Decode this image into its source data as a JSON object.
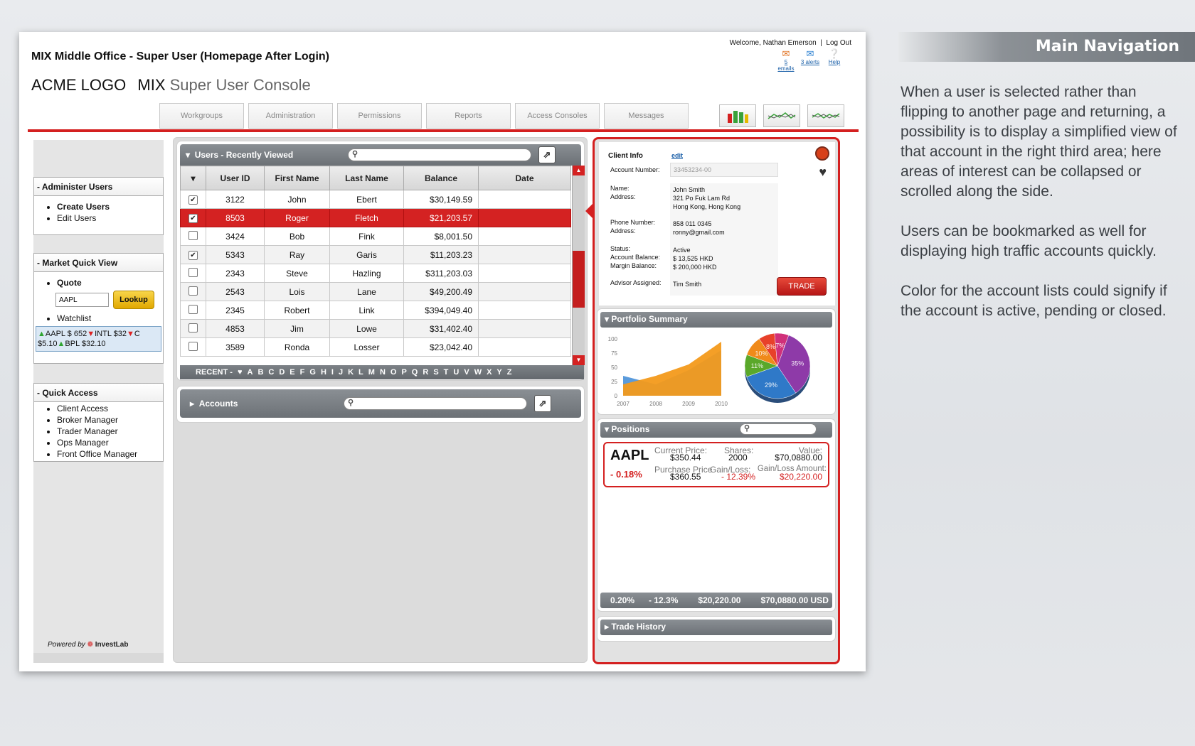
{
  "doc_title": "MIX Middle Office - Super User (Homepage After Login)",
  "header": {
    "welcome": "Welcome, Nathan Emerson",
    "logout": "Log Out",
    "emails": "5 emails",
    "alerts": "3 alerts",
    "help": "Help",
    "logo": "ACME LOGO",
    "app_mix": "MIX",
    "app_console": "Super User Console"
  },
  "tabs": [
    "Workgroups",
    "Administration",
    "Permissions",
    "Reports",
    "Access Consoles",
    "Messages"
  ],
  "sidebar": {
    "administer_title": "- Administer Users",
    "administer_items": [
      "Create Users",
      "Edit Users"
    ],
    "market_title": "- Market Quick View",
    "quote_label": "Quote",
    "quote_value": "AAPL",
    "lookup_label": "Lookup",
    "watchlist_label": "Watchlist",
    "watch_line1": "AAPL  $ 652",
    "watch_line1b": "INTL  $32",
    "watch_line1c": "C",
    "watch_line2": "$5.10",
    "watch_line2b": "BPL  $32.10",
    "quick_title": "- Quick Access",
    "quick_items": [
      "Client Access",
      "Broker Manager",
      "Trader Manager",
      "Ops Manager",
      "Front Office Manager"
    ],
    "powered_by": "Powered by",
    "brand": "InvestLab"
  },
  "users_grid": {
    "title": "Users - Recently Viewed",
    "columns": [
      "▾",
      "User ID",
      "First Name",
      "Last Name",
      "Balance",
      "Date"
    ],
    "rows": [
      {
        "checked": true,
        "id": "3122",
        "first": "John",
        "last": "Ebert",
        "balance": "$30,149.59",
        "date": ""
      },
      {
        "checked": true,
        "id": "8503",
        "first": "Roger",
        "last": "Fletch",
        "balance": "$21,203.57",
        "date": "",
        "selected": true
      },
      {
        "checked": false,
        "id": "3424",
        "first": "Bob",
        "last": "Fink",
        "balance": "$8,001.50",
        "date": ""
      },
      {
        "checked": true,
        "id": "5343",
        "first": "Ray",
        "last": "Garis",
        "balance": "$11,203.23",
        "date": ""
      },
      {
        "checked": false,
        "id": "2343",
        "first": "Steve",
        "last": "Hazling",
        "balance": "$311,203.03",
        "date": ""
      },
      {
        "checked": false,
        "id": "2543",
        "first": "Lois",
        "last": "Lane",
        "balance": "$49,200.49",
        "date": ""
      },
      {
        "checked": false,
        "id": "2345",
        "first": "Robert",
        "last": "Link",
        "balance": "$394,049.40",
        "date": ""
      },
      {
        "checked": false,
        "id": "4853",
        "first": "Jim",
        "last": "Lowe",
        "balance": "$31,402.40",
        "date": ""
      },
      {
        "checked": false,
        "id": "3589",
        "first": "Ronda",
        "last": "Losser",
        "balance": "$23,042.40",
        "date": ""
      }
    ],
    "alpha_recent": "RECENT  -",
    "alpha_heart": "♥",
    "letters": [
      "A",
      "B",
      "C",
      "D",
      "E",
      "F",
      "G",
      "H",
      "I",
      "J",
      "K",
      "L",
      "M",
      "N",
      "O",
      "P",
      "Q",
      "R",
      "S",
      "T",
      "U",
      "V",
      "W",
      "X",
      "Y",
      "Z"
    ]
  },
  "accounts": {
    "title": "Accounts"
  },
  "client": {
    "title": "Client Info",
    "edit": "edit",
    "account_number_label": "Account Number:",
    "account_number": "33453234-00",
    "name_label": "Name:",
    "address_label": "Address:",
    "name": "John Smith",
    "address1": "321 Po Fuk Lam Rd",
    "address2": "Hong Kong, Hong Kong",
    "phone_label": "Phone Number:",
    "email_label": "Address:",
    "phone": "858 011 0345",
    "email": "ronny@gmail.com",
    "status_label": "Status:",
    "acct_bal_label": "Account Balance:",
    "margin_label": "Margin Balance:",
    "status": "Active",
    "acct_bal": "$ 13,525 HKD",
    "margin": "$ 200,000 HKD",
    "advisor_label": "Advisor Assigned:",
    "advisor": "Tim Smith",
    "trade": "TRADE"
  },
  "portfolio": {
    "title": "Portfolio Summary",
    "y_ticks": [
      "100",
      "75",
      "50",
      "25",
      "0"
    ],
    "x_ticks": [
      "2007",
      "2008",
      "2009",
      "2010"
    ],
    "pie_labels": [
      "35%",
      "29%",
      "11%",
      "10%",
      "8%",
      "7%"
    ]
  },
  "positions": {
    "title": "Positions",
    "symbol": "AAPL",
    "change": "- 0.18%",
    "current_price_label": "Current Price:",
    "current_price": "$350.44",
    "purchase_price_label": "Purchase Price",
    "purchase_price": "$360.55",
    "shares_label": "Shares:",
    "shares": "2000",
    "gain_loss_label": "Gain/Loss:",
    "gain_loss": "- 12.39%",
    "value_label": "Value:",
    "value": "$70,0880.00",
    "gain_amount_label": "Gain/Loss Amount:",
    "gain_amount": "$20,220.00",
    "footer": [
      "0.20%",
      "- 12.3%",
      "$20,220.00",
      "$70,0880.00 USD"
    ]
  },
  "trade_history": {
    "title": "Trade History"
  },
  "annotation": {
    "heading": "Main Navigation",
    "p1": "When a user is selected rather than flipping to another page and returning, a possibility is to display a simplified view of that account in the right third area; here areas of interest can be collapsed or scrolled along the side.",
    "p2": "Users can be bookmarked as well for displaying high traffic accounts quickly.",
    "p3": "Color for the account lists could signify if the account is active, pending or closed."
  },
  "colors": {
    "accent_red": "#d42020",
    "up_green": "#2fa531",
    "chip_blue": "#dbe8f5"
  },
  "chart_data": {
    "type": "area",
    "x": [
      "2007",
      "2008",
      "2009",
      "2010"
    ],
    "ylim": [
      0,
      100
    ],
    "series": [
      {
        "values": [
          20,
          35,
          55,
          95
        ]
      },
      {
        "values": [
          35,
          20,
          45,
          80
        ]
      }
    ]
  }
}
